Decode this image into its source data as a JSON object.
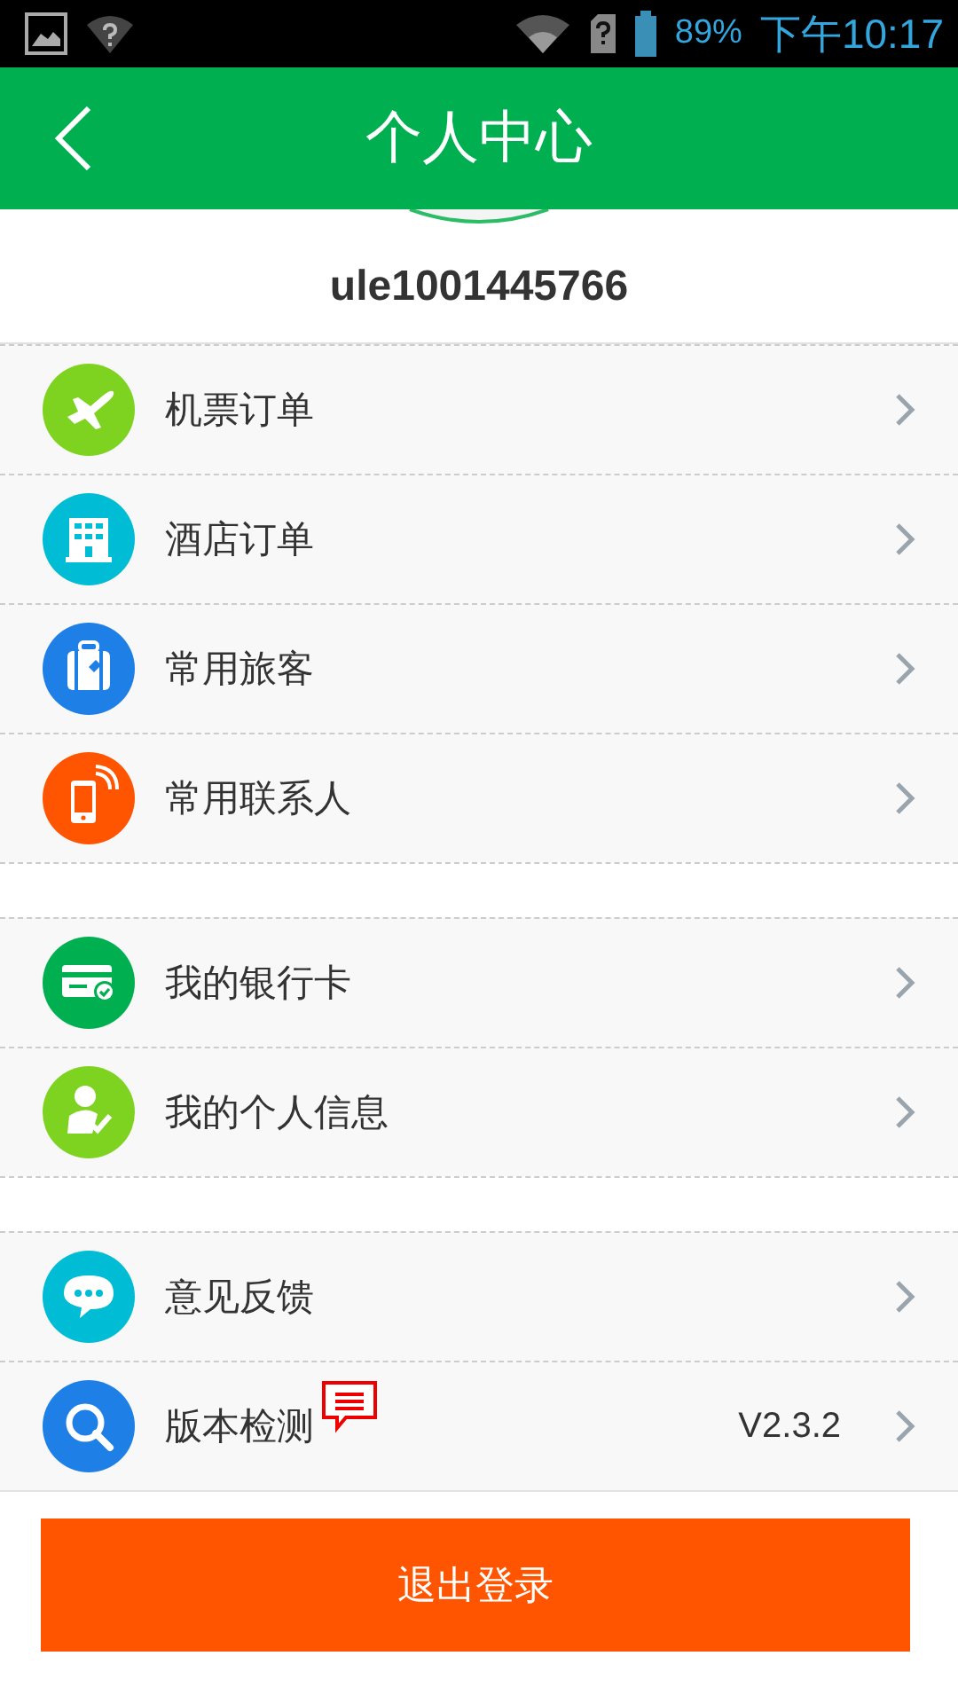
{
  "status_bar": {
    "battery": "89%",
    "time": "下午10:17"
  },
  "header": {
    "title": "个人中心"
  },
  "profile": {
    "username": "ule1001445766"
  },
  "groups": [
    [
      {
        "label": "机票订单",
        "kind": "plane",
        "color": "#7ed321"
      },
      {
        "label": "酒店订单",
        "kind": "building",
        "color": "#00bcd4"
      },
      {
        "label": "常用旅客",
        "kind": "luggage",
        "color": "#1e7fe6"
      },
      {
        "label": "常用联系人",
        "kind": "phone",
        "color": "#ff5500"
      }
    ],
    [
      {
        "label": "我的银行卡",
        "kind": "card",
        "color": "#00b050"
      },
      {
        "label": "我的个人信息",
        "kind": "person",
        "color": "#7ed321"
      }
    ],
    [
      {
        "label": "意见反馈",
        "kind": "chat",
        "color": "#00bcd4"
      },
      {
        "label": "版本检测",
        "kind": "search",
        "color": "#1e7fe6",
        "new_badge": true,
        "value": "V2.3.2"
      }
    ]
  ],
  "logout_button": "退出登录"
}
